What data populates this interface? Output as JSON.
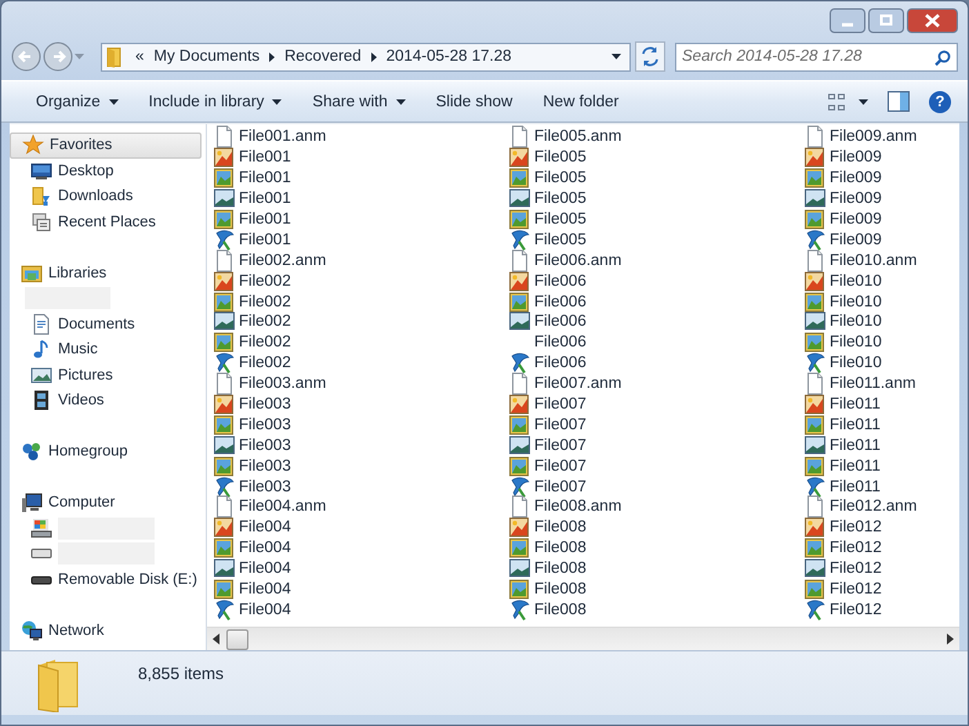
{
  "window": {
    "controls": [
      {
        "kind": "minimize"
      },
      {
        "kind": "maximize"
      },
      {
        "kind": "close"
      }
    ]
  },
  "address_bar": {
    "overflow": "«",
    "crumbs": [
      "My Documents",
      "Recovered",
      "2014-05-28 17.28"
    ]
  },
  "search": {
    "placeholder": "Search 2014-05-28 17.28"
  },
  "toolbar": [
    {
      "label": "Organize",
      "dropdown": true
    },
    {
      "label": "Include in library",
      "dropdown": true
    },
    {
      "label": "Share with",
      "dropdown": true
    },
    {
      "label": "Slide show",
      "dropdown": false
    },
    {
      "label": "New folder",
      "dropdown": false
    }
  ],
  "sidebar": [
    {
      "label": "Favorites",
      "kind": "favorites",
      "selected": true,
      "children": [
        {
          "label": "Desktop",
          "kind": "desktop",
          "selected": false
        },
        {
          "label": "Downloads",
          "kind": "downloads",
          "selected": false
        },
        {
          "label": "Recent Places",
          "kind": "recent",
          "selected": false
        }
      ]
    },
    {
      "label": "Libraries",
      "kind": "libraries",
      "selected": false,
      "children": [
        {
          "kind": "redacted"
        },
        {
          "label": "Documents",
          "kind": "documents",
          "selected": false
        },
        {
          "label": "Music",
          "kind": "music",
          "selected": false
        },
        {
          "label": "Pictures",
          "kind": "pictures",
          "selected": false
        },
        {
          "label": "Videos",
          "kind": "videos",
          "selected": false
        }
      ]
    },
    {
      "label": "Homegroup",
      "kind": "homegroup",
      "selected": false
    },
    {
      "label": "Computer",
      "kind": "computer",
      "selected": false,
      "children": [
        {
          "kind": "system-drive",
          "selected": false
        },
        {
          "kind": "drive",
          "selected": false
        },
        {
          "label": "Removable Disk (E:)",
          "kind": "removable",
          "selected": false
        }
      ]
    },
    {
      "label": "Network",
      "kind": "network",
      "selected": false
    }
  ],
  "help": {
    "label": "?"
  },
  "files": [
    {
      "name": "File001.anm",
      "kind": "anm"
    },
    {
      "name": "File001",
      "kind": "paint"
    },
    {
      "name": "File001",
      "kind": "photo"
    },
    {
      "name": "File001",
      "kind": "scene"
    },
    {
      "name": "File001",
      "kind": "photo"
    },
    {
      "name": "File001",
      "kind": "quill"
    },
    {
      "name": "File002.anm",
      "kind": "anm"
    },
    {
      "name": "File002",
      "kind": "paint"
    },
    {
      "name": "File002",
      "kind": "photo"
    },
    {
      "name": "File002",
      "kind": "scene"
    },
    {
      "name": "File002",
      "kind": "photo"
    },
    {
      "name": "File002",
      "kind": "quill"
    },
    {
      "name": "File003.anm",
      "kind": "anm"
    },
    {
      "name": "File003",
      "kind": "paint"
    },
    {
      "name": "File003",
      "kind": "photo"
    },
    {
      "name": "File003",
      "kind": "scene"
    },
    {
      "name": "File003",
      "kind": "photo"
    },
    {
      "name": "File003",
      "kind": "quill"
    },
    {
      "name": "File004.anm",
      "kind": "anm"
    },
    {
      "name": "File004",
      "kind": "paint"
    },
    {
      "name": "File004",
      "kind": "photo"
    },
    {
      "name": "File004",
      "kind": "scene"
    },
    {
      "name": "File004",
      "kind": "photo"
    },
    {
      "name": "File004",
      "kind": "quill"
    },
    {
      "name": "File005.anm",
      "kind": "anm"
    },
    {
      "name": "File005",
      "kind": "paint"
    },
    {
      "name": "File005",
      "kind": "photo"
    },
    {
      "name": "File005",
      "kind": "scene"
    },
    {
      "name": "File005",
      "kind": "photo"
    },
    {
      "name": "File005",
      "kind": "quill"
    },
    {
      "name": "File006.anm",
      "kind": "anm"
    },
    {
      "name": "File006",
      "kind": "paint"
    },
    {
      "name": "File006",
      "kind": "photo"
    },
    {
      "name": "File006",
      "kind": "scene"
    },
    {
      "name": "File006",
      "kind": "none"
    },
    {
      "name": "File006",
      "kind": "quill"
    },
    {
      "name": "File007.anm",
      "kind": "anm"
    },
    {
      "name": "File007",
      "kind": "paint"
    },
    {
      "name": "File007",
      "kind": "photo"
    },
    {
      "name": "File007",
      "kind": "scene"
    },
    {
      "name": "File007",
      "kind": "photo"
    },
    {
      "name": "File007",
      "kind": "quill"
    },
    {
      "name": "File008.anm",
      "kind": "anm"
    },
    {
      "name": "File008",
      "kind": "paint"
    },
    {
      "name": "File008",
      "kind": "photo"
    },
    {
      "name": "File008",
      "kind": "scene"
    },
    {
      "name": "File008",
      "kind": "photo"
    },
    {
      "name": "File008",
      "kind": "quill"
    },
    {
      "name": "File009.anm",
      "kind": "anm"
    },
    {
      "name": "File009",
      "kind": "paint"
    },
    {
      "name": "File009",
      "kind": "photo"
    },
    {
      "name": "File009",
      "kind": "scene"
    },
    {
      "name": "File009",
      "kind": "photo"
    },
    {
      "name": "File009",
      "kind": "quill"
    },
    {
      "name": "File010.anm",
      "kind": "anm"
    },
    {
      "name": "File010",
      "kind": "paint"
    },
    {
      "name": "File010",
      "kind": "photo"
    },
    {
      "name": "File010",
      "kind": "scene"
    },
    {
      "name": "File010",
      "kind": "photo"
    },
    {
      "name": "File010",
      "kind": "quill"
    },
    {
      "name": "File011.anm",
      "kind": "anm"
    },
    {
      "name": "File011",
      "kind": "paint"
    },
    {
      "name": "File011",
      "kind": "photo"
    },
    {
      "name": "File011",
      "kind": "scene"
    },
    {
      "name": "File011",
      "kind": "photo"
    },
    {
      "name": "File011",
      "kind": "quill"
    },
    {
      "name": "File012.anm",
      "kind": "anm"
    },
    {
      "name": "File012",
      "kind": "paint"
    },
    {
      "name": "File012",
      "kind": "photo"
    },
    {
      "name": "File012",
      "kind": "scene"
    },
    {
      "name": "File012",
      "kind": "photo"
    },
    {
      "name": "File012",
      "kind": "quill"
    }
  ],
  "status_bar": {
    "count": "8,855 items"
  }
}
